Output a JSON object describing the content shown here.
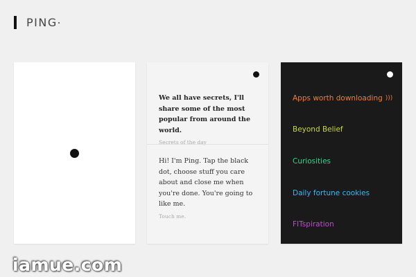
{
  "app": {
    "logo_text": "PING",
    "logo_suffix_icon": "dot-icon"
  },
  "cards": {
    "blank": {
      "center_icon": "black-dot-icon"
    },
    "messages": {
      "corner_icon": "black-dot-icon",
      "items": [
        {
          "text": "We all have secrets, I'll share some of the most popular from around the world.",
          "subtitle": "Secrets of the day"
        },
        {
          "text": "Hi! I'm Ping. Tap the black dot, choose stuff you care about and close me when you're done. You're going to like me.",
          "subtitle": "Touch me."
        }
      ]
    },
    "menu": {
      "corner_icon": "white-dot-icon",
      "items": [
        {
          "label": "Apps worth downloading",
          "color": "#f07f3c",
          "icon": "sound-wave-icon"
        },
        {
          "label": "Beyond Belief",
          "color": "#c8d64a"
        },
        {
          "label": "Curiosities",
          "color": "#3ecf8e"
        },
        {
          "label": "Daily fortune cookies",
          "color": "#3fb8e8"
        },
        {
          "label": "FITspiration",
          "color": "#c04ad0"
        }
      ]
    }
  },
  "watermark": "iamue.com",
  "colors": {
    "background": "#f0f0f0",
    "dark_card": "#1a1a1a",
    "light_card": "#f4f4f4",
    "blank_card": "#ffffff"
  }
}
